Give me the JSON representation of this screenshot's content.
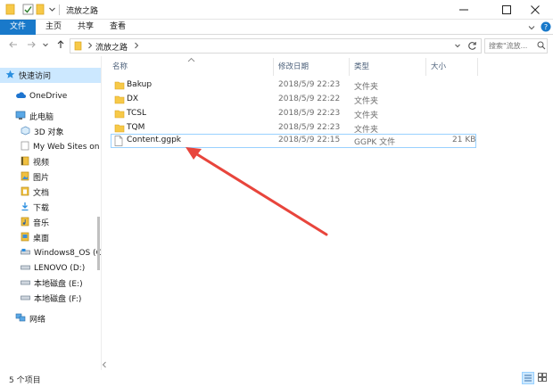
{
  "window": {
    "title": "流放之路",
    "icons": [
      "folder-icon",
      "checkmark-icon",
      "folder-icon",
      "dropdown-icon"
    ],
    "controls": [
      "minimize-icon",
      "maximize-icon",
      "close-icon"
    ]
  },
  "ribbon": {
    "tabs": [
      "文件",
      "主页",
      "共享",
      "查看"
    ],
    "expand_icon": "chevron-down-icon",
    "help_icon": "help-icon"
  },
  "navigation": {
    "back_icon": "back-arrow-icon",
    "forward_icon": "forward-arrow-icon",
    "recent_icon": "chevron-down-icon",
    "up_icon": "up-arrow-icon",
    "address_path": "流放之路",
    "refresh_icon": "refresh-icon",
    "search_placeholder": "搜索\"流放..."
  },
  "sidebar": {
    "items": [
      {
        "label": "快速访问",
        "icon": "star-icon"
      },
      {
        "label": "OneDrive",
        "icon": "cloud-icon"
      },
      {
        "label": "此电脑",
        "icon": "computer-icon"
      },
      {
        "label": "3D 对象",
        "icon": "cube-icon"
      },
      {
        "label": "My Web Sites on I",
        "icon": "web-icon"
      },
      {
        "label": "视频",
        "icon": "video-icon"
      },
      {
        "label": "图片",
        "icon": "picture-icon"
      },
      {
        "label": "文档",
        "icon": "document-icon"
      },
      {
        "label": "下载",
        "icon": "download-icon"
      },
      {
        "label": "音乐",
        "icon": "music-icon"
      },
      {
        "label": "桌面",
        "icon": "desktop-icon"
      },
      {
        "label": "Windows8_OS (C:)",
        "icon": "drive-icon"
      },
      {
        "label": "LENOVO (D:)",
        "icon": "drive-icon"
      },
      {
        "label": "本地磁盘 (E:)",
        "icon": "drive-icon"
      },
      {
        "label": "本地磁盘 (F:)",
        "icon": "drive-icon"
      },
      {
        "label": "网络",
        "icon": "network-icon"
      }
    ]
  },
  "file_list": {
    "columns": {
      "name": "名称",
      "modified": "修改日期",
      "type": "类型",
      "size": "大小"
    },
    "sort_icon": "sort-up-icon",
    "rows": [
      {
        "name": "Bakup",
        "modified": "2018/5/9 22:23",
        "type": "文件夹",
        "size": "",
        "icon": "folder-icon"
      },
      {
        "name": "DX",
        "modified": "2018/5/9 22:22",
        "type": "文件夹",
        "size": "",
        "icon": "folder-icon"
      },
      {
        "name": "TCSL",
        "modified": "2018/5/9 22:23",
        "type": "文件夹",
        "size": "",
        "icon": "folder-icon"
      },
      {
        "name": "TQM",
        "modified": "2018/5/9 22:23",
        "type": "文件夹",
        "size": "",
        "icon": "folder-icon"
      },
      {
        "name": "Content.ggpk",
        "modified": "2018/5/9 22:15",
        "type": "GGPK 文件",
        "size": "21 KB",
        "icon": "file-icon"
      }
    ]
  },
  "status": {
    "item_count": "5 个项目",
    "view_icons": [
      "details-view-icon",
      "large-icons-view-icon"
    ]
  },
  "colors": {
    "accent": "#1979ca",
    "selection": "#cce8ff",
    "row_border": "#99d1ff",
    "folder": "#f7c948",
    "arrow": "#e8453c"
  }
}
